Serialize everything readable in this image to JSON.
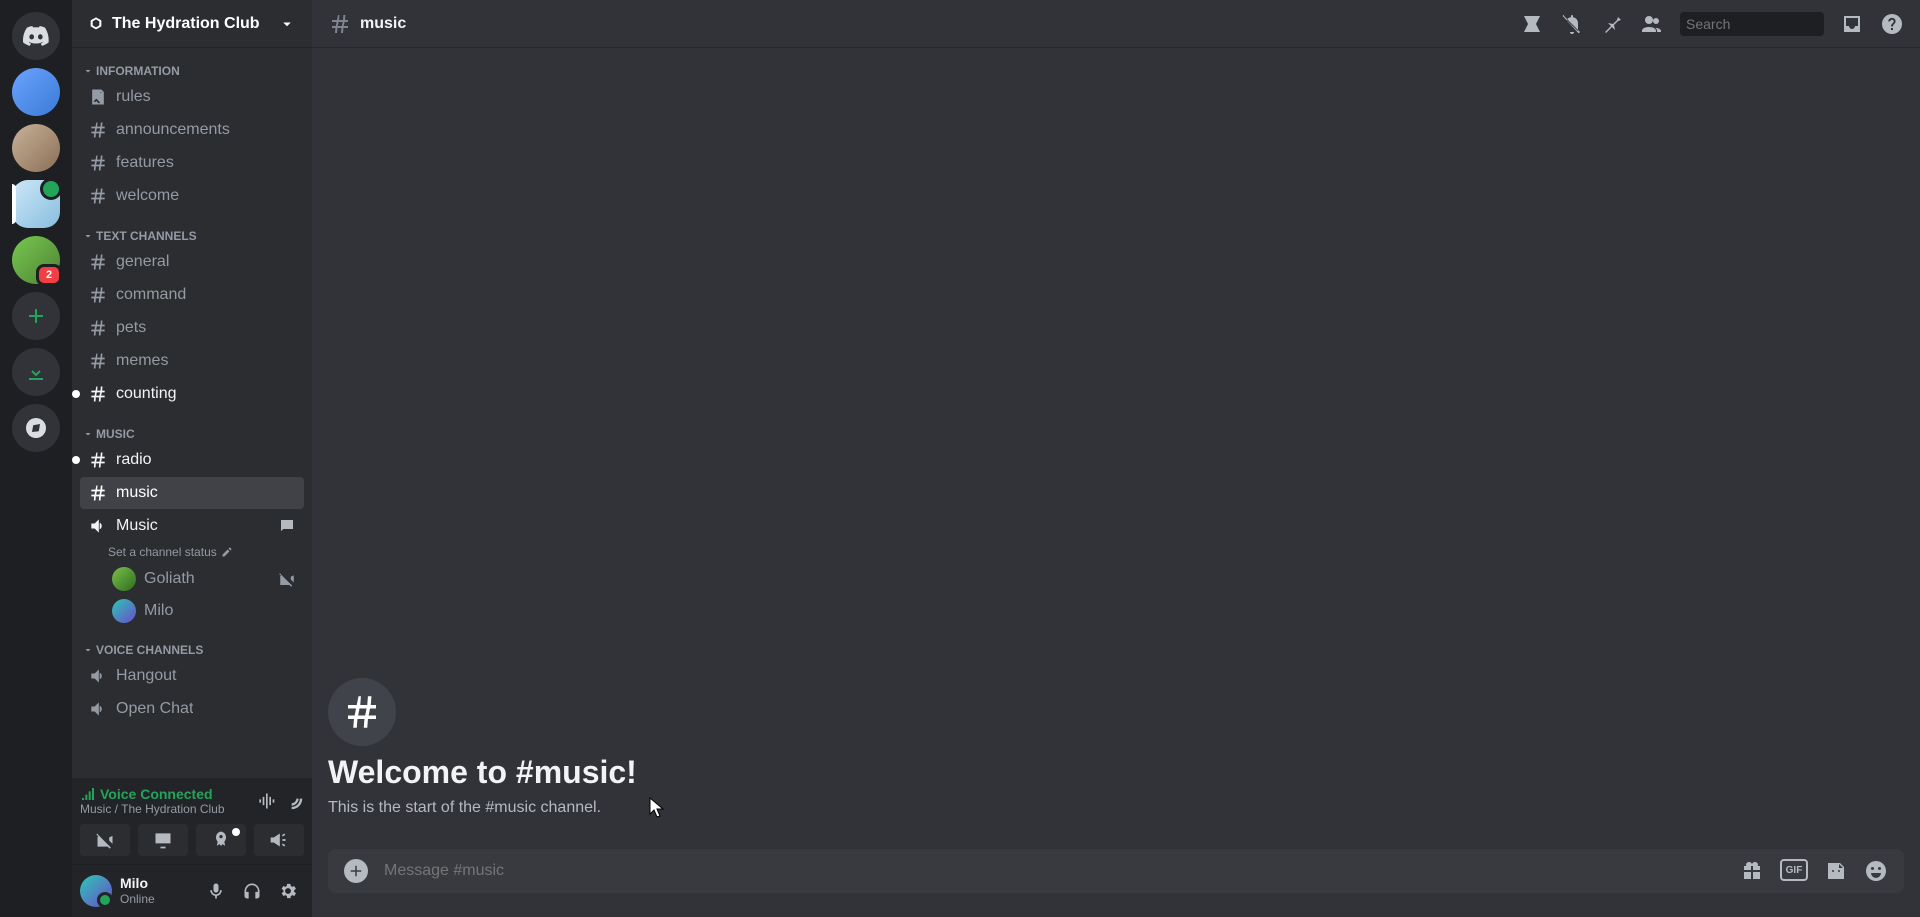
{
  "server": {
    "name": "The Hydration Club"
  },
  "server_list": {
    "badge_count": "2"
  },
  "categories": [
    {
      "name": "Information"
    },
    {
      "name": "Text Channels"
    },
    {
      "name": "Music"
    },
    {
      "name": "Voice Channels"
    }
  ],
  "channels": {
    "information": [
      {
        "name": "rules",
        "type": "rules"
      },
      {
        "name": "announcements",
        "type": "text"
      },
      {
        "name": "features",
        "type": "text"
      },
      {
        "name": "welcome",
        "type": "text"
      }
    ],
    "text": [
      {
        "name": "general",
        "type": "text"
      },
      {
        "name": "command",
        "type": "text"
      },
      {
        "name": "pets",
        "type": "text"
      },
      {
        "name": "memes",
        "type": "text"
      },
      {
        "name": "counting",
        "type": "text",
        "unread": true
      }
    ],
    "music": [
      {
        "name": "radio",
        "type": "text",
        "unread": true
      },
      {
        "name": "music",
        "type": "text",
        "active": true
      },
      {
        "name": "Music",
        "type": "voice",
        "status_prompt": "Set a channel status",
        "users": [
          {
            "name": "Goliath"
          },
          {
            "name": "Milo"
          }
        ]
      }
    ],
    "voice": [
      {
        "name": "Hangout",
        "type": "voice"
      },
      {
        "name": "Open Chat",
        "type": "voice"
      }
    ]
  },
  "voice_panel": {
    "status": "Voice Connected",
    "location": "Music / The Hydration Club"
  },
  "user": {
    "name": "Milo",
    "status": "Online"
  },
  "chat": {
    "channel_name": "music",
    "welcome_title": "Welcome to #music!",
    "welcome_sub": "This is the start of the #music channel."
  },
  "search": {
    "placeholder": "Search"
  },
  "composer": {
    "placeholder": "Message #music"
  },
  "gif_label": "GIF"
}
